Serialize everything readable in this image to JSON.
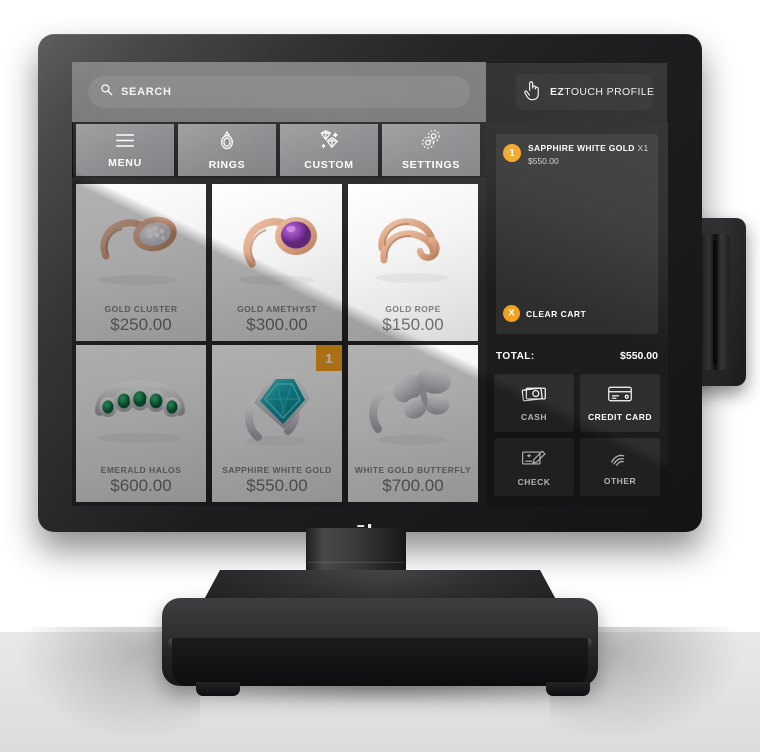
{
  "device": {
    "brand_logo": "ēlo",
    "side_module": "magnetic-stripe-reader"
  },
  "screen": {
    "search": {
      "icon": "search-icon",
      "value": "",
      "placeholder": "SEARCH"
    },
    "profile_button": {
      "icon": "pointing-hand-icon",
      "label_bold": "EZ",
      "label_rest": "TOUCH PROFILE"
    },
    "nav_tiles": [
      {
        "label": "MENU",
        "icon": "hamburger-menu-icon"
      },
      {
        "label": "RINGS",
        "icon": "ring-icon"
      },
      {
        "label": "CUSTOM",
        "icon": "gems-icon"
      },
      {
        "label": "SETTINGS",
        "icon": "gears-icon"
      }
    ],
    "products": [
      {
        "name": "GOLD CLUSTER",
        "price": "$250.00",
        "badge": "",
        "image": "rose-gold-cluster-ring"
      },
      {
        "name": "GOLD AMETHYST",
        "price": "$300.00",
        "badge": "",
        "image": "rose-gold-amethyst-ring"
      },
      {
        "name": "GOLD ROPE",
        "price": "$150.00",
        "badge": "",
        "image": "rose-gold-rope-ring"
      },
      {
        "name": "EMERALD HALOS",
        "price": "$600.00",
        "badge": "",
        "image": "emerald-halo-band"
      },
      {
        "name": "SAPPHIRE WHITE GOLD",
        "price": "$550.00",
        "badge": "1",
        "image": "sapphire-white-gold-ring"
      },
      {
        "name": "WHITE GOLD BUTTERFLY",
        "price": "$700.00",
        "badge": "",
        "image": "white-gold-butterfly-ring"
      }
    ],
    "cart": {
      "items": [
        {
          "qty": "1",
          "name": "SAPPHIRE WHITE GOLD",
          "qty_suffix": "X1",
          "price": "$550.00"
        }
      ],
      "clear_cart": {
        "icon_label": "X",
        "label": "CLEAR CART"
      },
      "total_label": "TOTAL:",
      "total_value": "$550.00",
      "payment_methods": [
        {
          "label": "CASH",
          "icon": "cash-icon"
        },
        {
          "label": "CREDIT CARD",
          "icon": "credit-card-icon"
        },
        {
          "label": "CHECK",
          "icon": "check-icon"
        },
        {
          "label": "OTHER",
          "icon": "contactless-icon"
        }
      ]
    }
  },
  "colors": {
    "accent_orange": "#f5a11d",
    "ui_grey": "#6f7173",
    "tile_grey": "#8a8b8e",
    "panel_dark": "#1d1d1d",
    "card_dark": "#2e2e2e"
  }
}
